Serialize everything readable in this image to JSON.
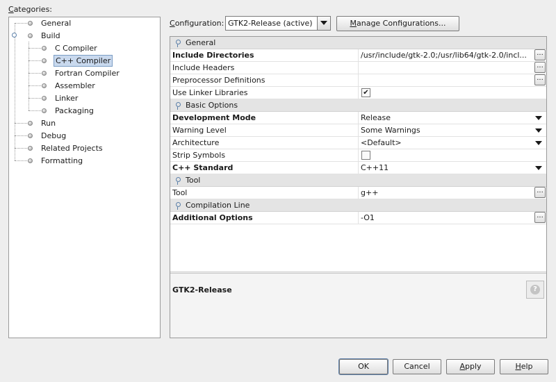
{
  "categories": {
    "label_prefix": "C",
    "label_rest": "ategories:",
    "items": [
      {
        "label": "General"
      },
      {
        "label": "Build"
      },
      {
        "label": "C Compiler"
      },
      {
        "label": "C++ Compiler"
      },
      {
        "label": "Fortran Compiler"
      },
      {
        "label": "Assembler"
      },
      {
        "label": "Linker"
      },
      {
        "label": "Packaging"
      },
      {
        "label": "Run"
      },
      {
        "label": "Debug"
      },
      {
        "label": "Related Projects"
      },
      {
        "label": "Formatting"
      }
    ],
    "selected": "C++ Compiler"
  },
  "configuration": {
    "label_prefix": "C",
    "label_rest": "onfiguration:",
    "selected": "GTK2-Release (active)",
    "manage_prefix": "M",
    "manage_rest": "anage Configurations..."
  },
  "sections": {
    "general": "General",
    "basic": "Basic Options",
    "tool": "Tool",
    "compilation": "Compilation Line"
  },
  "properties": {
    "include_dirs": {
      "name": "Include Directories",
      "value": "/usr/include/gtk-2.0;/usr/lib64/gtk-2.0/incl..."
    },
    "include_headers": {
      "name": "Include Headers",
      "value": ""
    },
    "preprocessor": {
      "name": "Preprocessor Definitions",
      "value": ""
    },
    "linker_libs": {
      "name": "Use Linker Libraries",
      "checked": true
    },
    "dev_mode": {
      "name": "Development Mode",
      "value": "Release"
    },
    "warning_level": {
      "name": "Warning Level",
      "value": "Some Warnings"
    },
    "architecture": {
      "name": "Architecture",
      "value": "<Default>"
    },
    "strip_symbols": {
      "name": "Strip Symbols",
      "checked": false
    },
    "cpp_standard": {
      "name": "C++ Standard",
      "value": "C++11"
    },
    "tool": {
      "name": "Tool",
      "value": "g++"
    },
    "additional_options": {
      "name": "Additional Options",
      "value": "-O1"
    }
  },
  "ellipsis": "...",
  "checkmark": "✔",
  "description": {
    "title": "GTK2-Release",
    "help_glyph": "?"
  },
  "buttons": {
    "ok": "OK",
    "cancel": "Cancel",
    "apply_prefix": "A",
    "apply_rest": "pply",
    "help_prefix": "H",
    "help_rest": "elp"
  },
  "colors": {
    "selection": "#c9d9ee",
    "section_bg": "#e4e4e4",
    "accent": "#5a7fa8"
  }
}
